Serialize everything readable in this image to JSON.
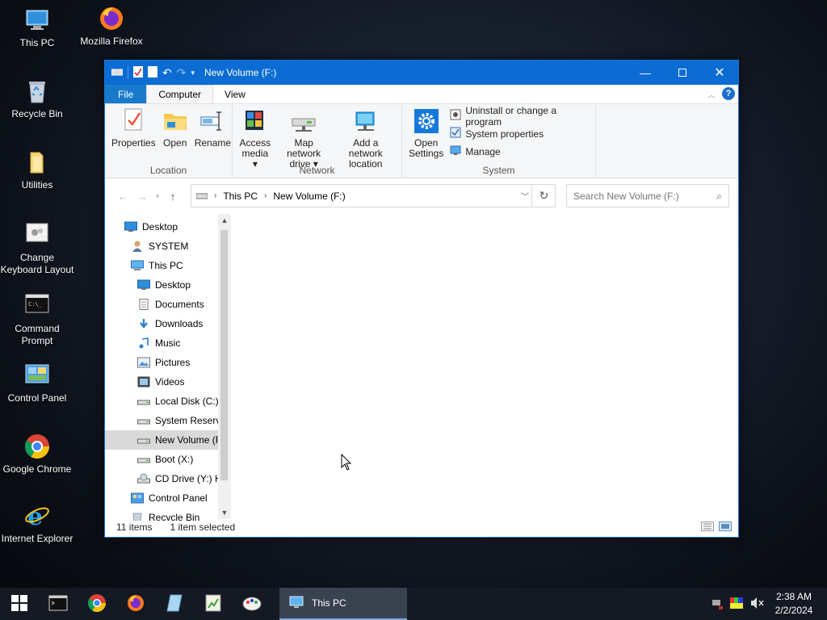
{
  "desktop": {
    "icons": [
      {
        "label": "This PC",
        "icon": "this-pc-icon"
      },
      {
        "label": "Mozilla Firefox",
        "icon": "firefox-icon"
      },
      {
        "label": "Recycle Bin",
        "icon": "recycle-bin-icon"
      },
      {
        "label": "Utilities",
        "icon": "folder-icon"
      },
      {
        "label": "Change Keyboard Layout",
        "icon": "keyboard-layout-icon"
      },
      {
        "label": "Command Prompt",
        "icon": "command-prompt-icon"
      },
      {
        "label": "Control Panel",
        "icon": "control-panel-icon"
      },
      {
        "label": "Google Chrome",
        "icon": "chrome-icon"
      },
      {
        "label": "Internet Explorer",
        "icon": "internet-explorer-icon"
      }
    ]
  },
  "window": {
    "title": "New Volume (F:)",
    "ribbon_tabs": [
      "File",
      "Computer",
      "View"
    ],
    "active_tab": "Computer",
    "groups": {
      "location": {
        "label": "Location",
        "buttons": [
          "Properties",
          "Open",
          "Rename"
        ]
      },
      "network": {
        "label": "Network",
        "buttons": [
          "Access media",
          "Map network drive",
          "Add a network location"
        ],
        "access_line1": "Access",
        "access_line2": "media",
        "map_line1": "Map network",
        "map_line2": "drive",
        "add_line1": "Add a network",
        "add_line2": "location"
      },
      "system": {
        "label": "System",
        "open_line1": "Open",
        "open_line2": "Settings",
        "small_buttons": [
          "Uninstall or change a program",
          "System properties",
          "Manage"
        ]
      }
    },
    "address": {
      "crumbs": [
        "This PC",
        "New Volume (F:)"
      ]
    },
    "search": {
      "placeholder": "Search New Volume (F:)"
    },
    "tree": [
      {
        "label": "Desktop",
        "indent": 0,
        "icon": "desktop-icon"
      },
      {
        "label": "SYSTEM",
        "indent": 1,
        "icon": "user-icon"
      },
      {
        "label": "This PC",
        "indent": 1,
        "icon": "this-pc-icon"
      },
      {
        "label": "Desktop",
        "indent": 2,
        "icon": "desktop-icon"
      },
      {
        "label": "Documents",
        "indent": 2,
        "icon": "documents-icon"
      },
      {
        "label": "Downloads",
        "indent": 2,
        "icon": "downloads-icon"
      },
      {
        "label": "Music",
        "indent": 2,
        "icon": "music-icon"
      },
      {
        "label": "Pictures",
        "indent": 2,
        "icon": "pictures-icon"
      },
      {
        "label": "Videos",
        "indent": 2,
        "icon": "videos-icon"
      },
      {
        "label": "Local Disk (C:)",
        "indent": 2,
        "icon": "drive-icon"
      },
      {
        "label": "System Reserve",
        "indent": 2,
        "icon": "drive-icon"
      },
      {
        "label": "New Volume (F",
        "indent": 2,
        "icon": "drive-icon",
        "selected": true
      },
      {
        "label": "Boot (X:)",
        "indent": 2,
        "icon": "drive-icon"
      },
      {
        "label": "CD Drive (Y:) H",
        "indent": 2,
        "icon": "cd-drive-icon"
      },
      {
        "label": "Control Panel",
        "indent": 1,
        "icon": "control-panel-icon"
      },
      {
        "label": "Recycle Bin",
        "indent": 1,
        "icon": "recycle-bin-icon"
      }
    ],
    "status": {
      "items": "11 items",
      "selected": "1 item selected"
    }
  },
  "taskbar": {
    "active_window_label": "This PC",
    "pinned": [
      "start-icon",
      "command-prompt-icon",
      "chrome-icon",
      "firefox-icon",
      "notepad-icon",
      "spreadsheet-icon",
      "paint-icon"
    ],
    "clock_time": "2:38 AM",
    "clock_date": "2/2/2024"
  }
}
